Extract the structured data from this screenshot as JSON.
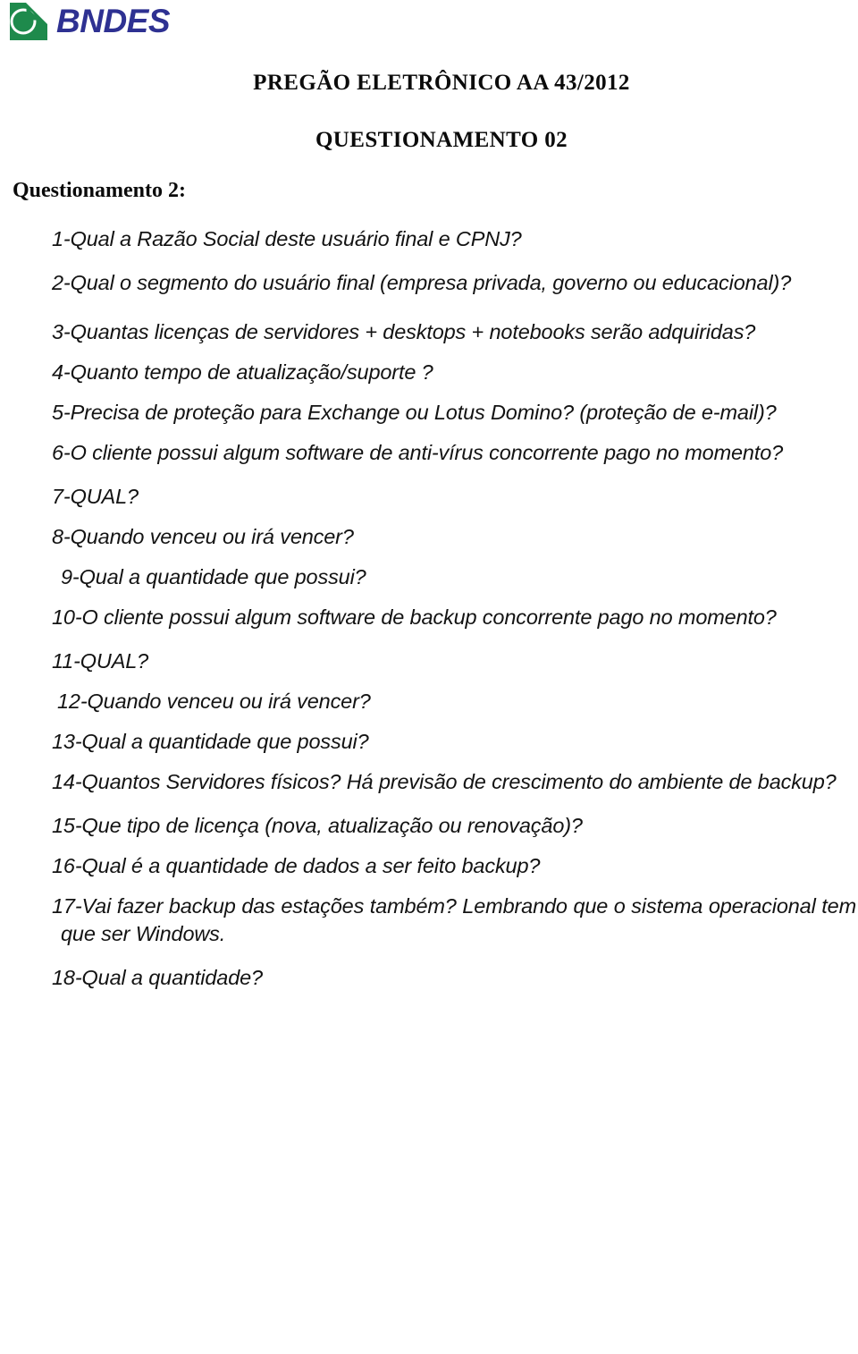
{
  "document": {
    "brand": {
      "logo_icon": "bndes-logo-icon",
      "wordmark": "BNDES",
      "mark_green": "#1E8A4C",
      "wordmark_blue": "#2E3192"
    },
    "title_lines": [
      "PREGÃO ELETRÔNICO AA 43/2012",
      "QUESTIONAMENTO 02"
    ],
    "section_heading": "Questionamento 2:",
    "questions": [
      "1-Qual a Razão Social deste usuário final e CPNJ?",
      "2-Qual o segmento do usuário final (empresa privada, governo ou educacional)?",
      "3-Quantas licenças de servidores + desktops + notebooks serão adquiridas?",
      "4-Quanto tempo de atualização/suporte ?",
      "5-Precisa de proteção para Exchange ou Lotus Domino? (proteção de e-mail)?",
      "6-O cliente possui algum software de anti-vírus concorrente pago no momento?",
      "7-QUAL?",
      "8-Quando venceu ou irá vencer?",
      "9-Qual a quantidade que possui?",
      "10-O cliente possui algum software de backup concorrente pago no momento?",
      "11-QUAL?",
      "12-Quando venceu ou irá vencer?",
      "13-Qual a quantidade que possui?",
      "14-Quantos Servidores físicos? Há previsão de crescimento do ambiente de backup?",
      "15-Que tipo de licença (nova, atualização ou renovação)?",
      "16-Qual é a quantidade de dados a ser feito backup?",
      "17-Vai fazer backup das estações também? Lembrando que o sistema operacional tem que ser Windows.",
      "18-Qual a quantidade?"
    ]
  }
}
